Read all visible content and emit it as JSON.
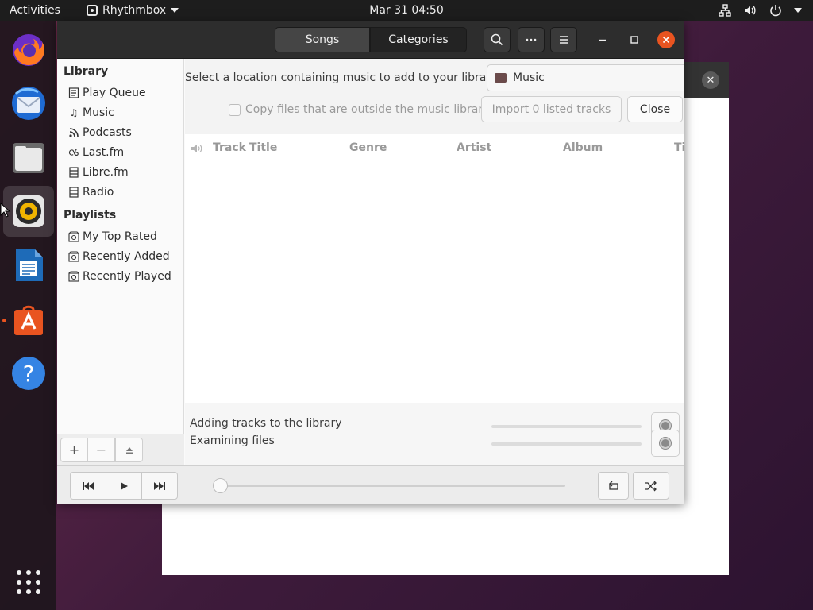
{
  "topbar": {
    "activities": "Activities",
    "app_name": "Rhythmbox",
    "clock": "Mar 31  04:50",
    "tray_icons": [
      "network-icon",
      "volume-icon",
      "power-icon",
      "caret-down-icon"
    ]
  },
  "dock": {
    "items": [
      "firefox",
      "thunderbird",
      "files",
      "rhythmbox",
      "libreoffice-writer",
      "ubuntu-software",
      "help"
    ],
    "active": "rhythmbox",
    "show_apps": "show-applications"
  },
  "header": {
    "tab_songs": "Songs",
    "tab_categories": "Categories",
    "accent_color": "#e95420"
  },
  "sidebar": {
    "library_title": "Library",
    "library_items": [
      {
        "label": "Play Queue",
        "icon": "play-queue-icon"
      },
      {
        "label": "Music",
        "icon": "music-note-icon"
      },
      {
        "label": "Podcasts",
        "icon": "rss-icon"
      },
      {
        "label": "Last.fm",
        "icon": "lastfm-icon"
      },
      {
        "label": "Libre.fm",
        "icon": "server-icon"
      },
      {
        "label": "Radio",
        "icon": "radio-icon"
      }
    ],
    "playlists_title": "Playlists",
    "playlist_items": [
      {
        "label": "My Top Rated",
        "icon": "smart-playlist-icon"
      },
      {
        "label": "Recently Added",
        "icon": "smart-playlist-icon"
      },
      {
        "label": "Recently Played",
        "icon": "smart-playlist-icon"
      }
    ]
  },
  "import": {
    "location_label": "Select a location containing music to add to your library:",
    "folder": "Music",
    "copy_label": "Copy files that are outside the music library",
    "copy_checked": false,
    "import_button": "Import 0 listed tracks",
    "close_button": "Close"
  },
  "tracklist": {
    "columns": [
      "Track",
      "Title",
      "Genre",
      "Artist",
      "Album",
      "Ti"
    ],
    "rows": []
  },
  "progress": [
    {
      "label": "Adding tracks to the library",
      "value": 0
    },
    {
      "label": "Examining files",
      "value": 0
    }
  ],
  "player": {
    "position": 0
  }
}
